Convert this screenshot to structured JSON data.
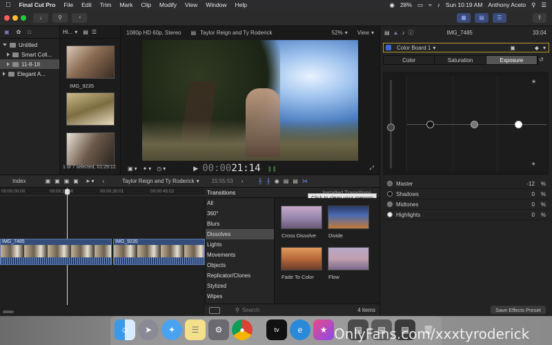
{
  "menubar": {
    "apple": "",
    "app_name": "Final Cut Pro",
    "menus": [
      "File",
      "Edit",
      "Trim",
      "Mark",
      "Clip",
      "Modify",
      "View",
      "Window",
      "Help"
    ],
    "battery": "28%",
    "datetime": "Sun 10:19 AM",
    "user": "Anthony Aceto"
  },
  "libraries": {
    "items": [
      {
        "label": "Untitled",
        "level": 0,
        "open": true
      },
      {
        "label": "Smart Coll...",
        "level": 1
      },
      {
        "label": "11-8-18",
        "level": 1,
        "selected": true
      },
      {
        "label": "Elegant A...",
        "level": 1
      }
    ]
  },
  "browser": {
    "filter_label": "Hi...",
    "clip_name": "IMG_9235",
    "status": "1 of 7 selected, 01:29:12"
  },
  "viewer": {
    "format": "1080p HD 60p, Stereo",
    "project": "Taylor Reign and Ty Roderick",
    "zoom": "52%",
    "view_label": "View",
    "timecode_dim": "00:00",
    "timecode_live": "21:14"
  },
  "timeline": {
    "index_label": "Index",
    "project": "Taylor Reign and Ty Roderick",
    "duration": "15:55:53",
    "ruler": [
      "00:00:00:00",
      "00:00:15:00",
      "00:00:30:01",
      "00:00:45:02"
    ],
    "clips": [
      {
        "name": "IMG_7485"
      },
      {
        "name": "IMG_9235"
      }
    ]
  },
  "transitions": {
    "header": "Transitions",
    "installed": "Installed Transitions",
    "tooltip": "Click to clean your memory",
    "categories": [
      "All",
      "360°",
      "Blurs",
      "Dissolves",
      "Lights",
      "Movements",
      "Objects",
      "Replicator/Clones",
      "Stylized",
      "Wipes"
    ],
    "selected": "Dissolves",
    "tiles": [
      {
        "label": "Cross Dissolve",
        "style": "pastel-a"
      },
      {
        "label": "Divide",
        "style": "pastel-b"
      },
      {
        "label": "Fade To Color",
        "style": "pastel-c"
      },
      {
        "label": "Flow",
        "style": "pastel-d"
      }
    ],
    "search_placeholder": "Search",
    "count": "4 items"
  },
  "inspector": {
    "clip_name": "IMG_7485",
    "duration": "33:04",
    "effect": "Color Board 1",
    "tabs": [
      "Color",
      "Saturation",
      "Exposure"
    ],
    "active_tab": "Exposure",
    "params": [
      {
        "label": "Master",
        "value": "-12",
        "unit": "%"
      },
      {
        "label": "Shadows",
        "value": "0",
        "unit": "%"
      },
      {
        "label": "Midtones",
        "value": "0",
        "unit": "%"
      },
      {
        "label": "Highlights",
        "value": "0",
        "unit": "%"
      }
    ],
    "save_preset": "Save Effects Preset"
  },
  "watermark": "OnlyFans.com/xxxtyroderick",
  "colors": {
    "accent": "#3a4a7a",
    "selection": "#4a4a4a",
    "clip": "#344d7a"
  }
}
